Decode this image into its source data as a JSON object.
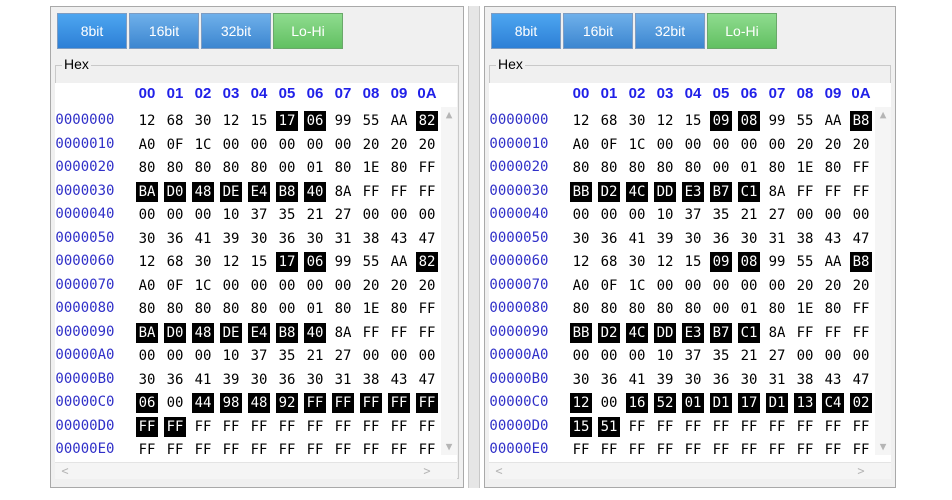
{
  "panes": [
    {
      "id": "left",
      "buttons": [
        {
          "label": "8bit",
          "state": "active"
        },
        {
          "label": "16bit",
          "state": "normal"
        },
        {
          "label": "32bit",
          "state": "normal"
        },
        {
          "label": "Lo-Hi",
          "state": "toggle"
        }
      ],
      "group_label": "Hex",
      "columns": [
        "00",
        "01",
        "02",
        "03",
        "04",
        "05",
        "06",
        "07",
        "08",
        "09",
        "0A"
      ],
      "rows": [
        {
          "addr": "00000000",
          "bytes": [
            "12",
            "68",
            "30",
            "12",
            "15",
            "17",
            "06",
            "99",
            "55",
            "AA",
            "82"
          ],
          "hl": [
            5,
            6,
            10
          ]
        },
        {
          "addr": "00000010",
          "bytes": [
            "A0",
            "0F",
            "1C",
            "00",
            "00",
            "00",
            "00",
            "00",
            "20",
            "20",
            "20"
          ],
          "hl": []
        },
        {
          "addr": "00000020",
          "bytes": [
            "80",
            "80",
            "80",
            "80",
            "80",
            "00",
            "01",
            "80",
            "1E",
            "80",
            "FF"
          ],
          "hl": []
        },
        {
          "addr": "00000030",
          "bytes": [
            "BA",
            "D0",
            "48",
            "DE",
            "E4",
            "B8",
            "40",
            "8A",
            "FF",
            "FF",
            "FF"
          ],
          "hl": [
            0,
            1,
            2,
            3,
            4,
            5,
            6
          ]
        },
        {
          "addr": "00000040",
          "bytes": [
            "00",
            "00",
            "00",
            "10",
            "37",
            "35",
            "21",
            "27",
            "00",
            "00",
            "00"
          ],
          "hl": []
        },
        {
          "addr": "00000050",
          "bytes": [
            "30",
            "36",
            "41",
            "39",
            "30",
            "36",
            "30",
            "31",
            "38",
            "43",
            "47"
          ],
          "hl": []
        },
        {
          "addr": "00000060",
          "bytes": [
            "12",
            "68",
            "30",
            "12",
            "15",
            "17",
            "06",
            "99",
            "55",
            "AA",
            "82"
          ],
          "hl": [
            5,
            6,
            10
          ]
        },
        {
          "addr": "00000070",
          "bytes": [
            "A0",
            "0F",
            "1C",
            "00",
            "00",
            "00",
            "00",
            "00",
            "20",
            "20",
            "20"
          ],
          "hl": []
        },
        {
          "addr": "00000080",
          "bytes": [
            "80",
            "80",
            "80",
            "80",
            "80",
            "00",
            "01",
            "80",
            "1E",
            "80",
            "FF"
          ],
          "hl": []
        },
        {
          "addr": "00000090",
          "bytes": [
            "BA",
            "D0",
            "48",
            "DE",
            "E4",
            "B8",
            "40",
            "8A",
            "FF",
            "FF",
            "FF"
          ],
          "hl": [
            0,
            1,
            2,
            3,
            4,
            5,
            6
          ]
        },
        {
          "addr": "000000A0",
          "bytes": [
            "00",
            "00",
            "00",
            "10",
            "37",
            "35",
            "21",
            "27",
            "00",
            "00",
            "00"
          ],
          "hl": []
        },
        {
          "addr": "000000B0",
          "bytes": [
            "30",
            "36",
            "41",
            "39",
            "30",
            "36",
            "30",
            "31",
            "38",
            "43",
            "47"
          ],
          "hl": []
        },
        {
          "addr": "000000C0",
          "bytes": [
            "06",
            "00",
            "44",
            "98",
            "48",
            "92",
            "FF",
            "FF",
            "FF",
            "FF",
            "FF"
          ],
          "hl": [
            0,
            2,
            3,
            4,
            5,
            6,
            7,
            8,
            9,
            10
          ]
        },
        {
          "addr": "000000D0",
          "bytes": [
            "FF",
            "FF",
            "FF",
            "FF",
            "FF",
            "FF",
            "FF",
            "FF",
            "FF",
            "FF",
            "FF"
          ],
          "hl": [
            0,
            1
          ]
        },
        {
          "addr": "000000E0",
          "bytes": [
            "FF",
            "FF",
            "FF",
            "FF",
            "FF",
            "FF",
            "FF",
            "FF",
            "FF",
            "FF",
            "FF"
          ],
          "hl": []
        }
      ]
    },
    {
      "id": "right",
      "buttons": [
        {
          "label": "8bit",
          "state": "active"
        },
        {
          "label": "16bit",
          "state": "normal"
        },
        {
          "label": "32bit",
          "state": "normal"
        },
        {
          "label": "Lo-Hi",
          "state": "toggle"
        }
      ],
      "group_label": "Hex",
      "columns": [
        "00",
        "01",
        "02",
        "03",
        "04",
        "05",
        "06",
        "07",
        "08",
        "09",
        "0A"
      ],
      "rows": [
        {
          "addr": "00000000",
          "bytes": [
            "12",
            "68",
            "30",
            "12",
            "15",
            "09",
            "08",
            "99",
            "55",
            "AA",
            "B8"
          ],
          "hl": [
            5,
            6,
            10
          ]
        },
        {
          "addr": "00000010",
          "bytes": [
            "A0",
            "0F",
            "1C",
            "00",
            "00",
            "00",
            "00",
            "00",
            "20",
            "20",
            "20"
          ],
          "hl": []
        },
        {
          "addr": "00000020",
          "bytes": [
            "80",
            "80",
            "80",
            "80",
            "80",
            "00",
            "01",
            "80",
            "1E",
            "80",
            "FF"
          ],
          "hl": []
        },
        {
          "addr": "00000030",
          "bytes": [
            "BB",
            "D2",
            "4C",
            "DD",
            "E3",
            "B7",
            "C1",
            "8A",
            "FF",
            "FF",
            "FF"
          ],
          "hl": [
            0,
            1,
            2,
            3,
            4,
            5,
            6
          ]
        },
        {
          "addr": "00000040",
          "bytes": [
            "00",
            "00",
            "00",
            "10",
            "37",
            "35",
            "21",
            "27",
            "00",
            "00",
            "00"
          ],
          "hl": []
        },
        {
          "addr": "00000050",
          "bytes": [
            "30",
            "36",
            "41",
            "39",
            "30",
            "36",
            "30",
            "31",
            "38",
            "43",
            "47"
          ],
          "hl": []
        },
        {
          "addr": "00000060",
          "bytes": [
            "12",
            "68",
            "30",
            "12",
            "15",
            "09",
            "08",
            "99",
            "55",
            "AA",
            "B8"
          ],
          "hl": [
            5,
            6,
            10
          ]
        },
        {
          "addr": "00000070",
          "bytes": [
            "A0",
            "0F",
            "1C",
            "00",
            "00",
            "00",
            "00",
            "00",
            "20",
            "20",
            "20"
          ],
          "hl": []
        },
        {
          "addr": "00000080",
          "bytes": [
            "80",
            "80",
            "80",
            "80",
            "80",
            "00",
            "01",
            "80",
            "1E",
            "80",
            "FF"
          ],
          "hl": []
        },
        {
          "addr": "00000090",
          "bytes": [
            "BB",
            "D2",
            "4C",
            "DD",
            "E3",
            "B7",
            "C1",
            "8A",
            "FF",
            "FF",
            "FF"
          ],
          "hl": [
            0,
            1,
            2,
            3,
            4,
            5,
            6
          ]
        },
        {
          "addr": "000000A0",
          "bytes": [
            "00",
            "00",
            "00",
            "10",
            "37",
            "35",
            "21",
            "27",
            "00",
            "00",
            "00"
          ],
          "hl": []
        },
        {
          "addr": "000000B0",
          "bytes": [
            "30",
            "36",
            "41",
            "39",
            "30",
            "36",
            "30",
            "31",
            "38",
            "43",
            "47"
          ],
          "hl": []
        },
        {
          "addr": "000000C0",
          "bytes": [
            "12",
            "00",
            "16",
            "52",
            "01",
            "D1",
            "17",
            "D1",
            "13",
            "C4",
            "02"
          ],
          "hl": [
            0,
            2,
            3,
            4,
            5,
            6,
            7,
            8,
            9,
            10
          ]
        },
        {
          "addr": "000000D0",
          "bytes": [
            "15",
            "51",
            "FF",
            "FF",
            "FF",
            "FF",
            "FF",
            "FF",
            "FF",
            "FF",
            "FF"
          ],
          "hl": [
            0,
            1
          ]
        },
        {
          "addr": "000000E0",
          "bytes": [
            "FF",
            "FF",
            "FF",
            "FF",
            "FF",
            "FF",
            "FF",
            "FF",
            "FF",
            "FF",
            "FF"
          ],
          "hl": []
        }
      ]
    }
  ],
  "scroll_icons": {
    "up": "▲",
    "down": "▼",
    "left": "<",
    "right": ">"
  }
}
